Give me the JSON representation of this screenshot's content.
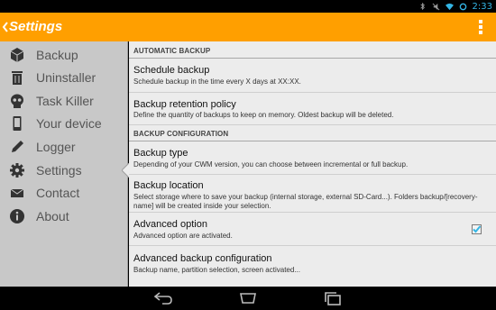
{
  "status_bar": {
    "time": "2:33",
    "icons": [
      "bluetooth-icon",
      "mute-icon",
      "wifi-icon",
      "sync-icon"
    ],
    "accent": "#33b5e5"
  },
  "action_bar": {
    "title": "Settings",
    "color": "#ff9f00"
  },
  "drawer": {
    "items": [
      {
        "label": "Backup",
        "icon": "cube-icon",
        "selected": false
      },
      {
        "label": "Uninstaller",
        "icon": "recycle-bin-icon",
        "selected": false
      },
      {
        "label": "Task Killer",
        "icon": "skull-icon",
        "selected": false
      },
      {
        "label": "Your device",
        "icon": "phone-icon",
        "selected": false
      },
      {
        "label": "Logger",
        "icon": "pencil-icon",
        "selected": false
      },
      {
        "label": "Settings",
        "icon": "gear-icon",
        "selected": true
      },
      {
        "label": "Contact",
        "icon": "envelope-icon",
        "selected": false
      },
      {
        "label": "About",
        "icon": "info-icon",
        "selected": false
      }
    ]
  },
  "content": {
    "sections": [
      {
        "header": "AUTOMATIC BACKUP",
        "prefs": [
          {
            "title": "Schedule backup",
            "summary": "Schedule backup in the time every X days at XX:XX."
          },
          {
            "title": "Backup retention policy",
            "summary": "Define the quantity of backups to keep on memory. Oldest backup will be deleted."
          }
        ]
      },
      {
        "header": "BACKUP CONFIGURATION",
        "prefs": [
          {
            "title": "Backup type",
            "summary": "Depending of your CWM version, you can choose between incremental or full backup."
          },
          {
            "title": "Backup location",
            "summary": "Select storage where to save your backup (internal storage, external SD-Card...). Folders backup/[recovery-name] will be created inside your selection."
          },
          {
            "title": "Advanced option",
            "summary": "Advanced option are activated.",
            "checked": true
          },
          {
            "title": "Advanced backup configuration",
            "summary": "Backup name, partition selection, screen activated..."
          }
        ]
      }
    ]
  },
  "nav_bar": {
    "buttons": [
      "back-icon",
      "home-icon",
      "recents-icon"
    ]
  }
}
